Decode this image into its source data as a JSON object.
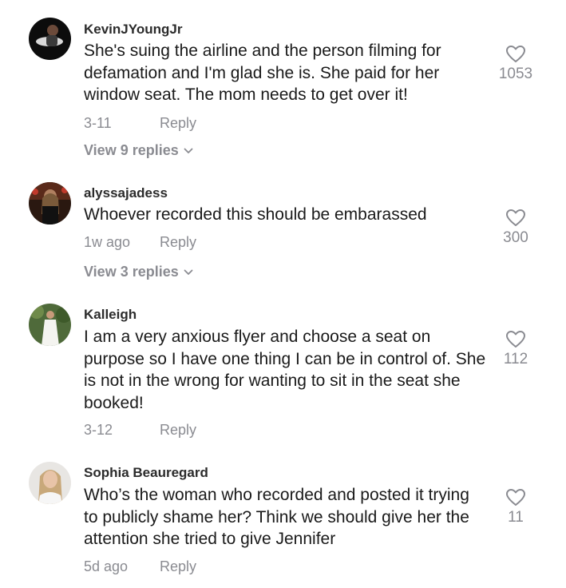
{
  "comments": [
    {
      "username": "KevinJYoungJr",
      "text": "She's suing the airline and the person filming for defamation and I'm glad she is. She paid for her window seat. The mom needs to get over it!",
      "date": "3-11",
      "reply_label": "Reply",
      "likes": "1053",
      "view_replies": "View 9 replies"
    },
    {
      "username": "alyssajadess",
      "text": "Whoever recorded this should be embarassed",
      "date": "1w ago",
      "reply_label": "Reply",
      "likes": "300",
      "view_replies": "View 3 replies"
    },
    {
      "username": "Kalleigh",
      "text": "I am a very anxious flyer and choose a seat on purpose so I have one thing I can be in control of. She is not in the wrong for wanting to sit in the seat she booked!",
      "date": "3-12",
      "reply_label": "Reply",
      "likes": "112"
    },
    {
      "username": "Sophia Beauregard",
      "text": "Who’s the woman who recorded and posted it trying to publicly shame her? Think we should give her the attention she tried to give Jennifer",
      "date": "5d ago",
      "reply_label": "Reply",
      "likes": "11"
    }
  ],
  "icons": {
    "like": "heart-outline-icon",
    "expand": "chevron-down-icon"
  },
  "colors": {
    "text": "#1a1a1a",
    "muted": "#8a8b91",
    "username": "#2b2b2b",
    "background": "#ffffff"
  }
}
